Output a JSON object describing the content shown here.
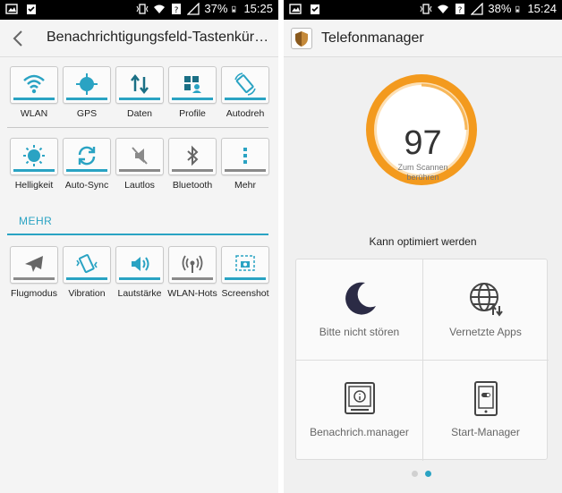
{
  "left": {
    "status": {
      "battery": "37%",
      "time": "15:25"
    },
    "title": "Benachrichtigungsfeld-Tastenkür…",
    "row1": [
      {
        "label": "WLAN",
        "icon": "wifi-icon",
        "active": true
      },
      {
        "label": "GPS",
        "icon": "gps-icon",
        "active": true
      },
      {
        "label": "Daten",
        "icon": "data-transfer-icon",
        "active": true
      },
      {
        "label": "Profile",
        "icon": "profile-icon",
        "active": true
      },
      {
        "label": "Autodreh",
        "icon": "rotate-icon",
        "active": true
      }
    ],
    "row2": [
      {
        "label": "Helligkeit",
        "icon": "brightness-icon",
        "active": true
      },
      {
        "label": "Auto-Sync",
        "icon": "sync-icon",
        "active": true
      },
      {
        "label": "Lautlos",
        "icon": "silent-icon",
        "active": false
      },
      {
        "label": "Bluetooth",
        "icon": "bluetooth-icon",
        "active": false
      },
      {
        "label": "Mehr",
        "icon": "more-icon",
        "active": false
      }
    ],
    "mehr_heading": "MEHR",
    "row3": [
      {
        "label": "Flugmodus",
        "icon": "airplane-icon",
        "active": false
      },
      {
        "label": "Vibration",
        "icon": "vibration-icon",
        "active": true
      },
      {
        "label": "Lautstärke",
        "icon": "volume-icon",
        "active": true
      },
      {
        "label": "WLAN-Hots",
        "icon": "hotspot-icon",
        "active": false
      },
      {
        "label": "Screenshot",
        "icon": "screenshot-icon",
        "active": true
      }
    ]
  },
  "right": {
    "status": {
      "battery": "38%",
      "time": "15:24"
    },
    "title": "Telefonmanager",
    "score": "97",
    "scan_line1": "Zum Scannen",
    "scan_line2": "berühren",
    "optimize_text": "Kann optimiert werden",
    "cells": [
      {
        "label": "Bitte nicht stören",
        "icon": "moon-icon"
      },
      {
        "label": "Vernetzte Apps",
        "icon": "globe-network-icon"
      },
      {
        "label": "Benachrich.manager",
        "icon": "notification-manager-icon"
      },
      {
        "label": "Start-Manager",
        "icon": "startup-manager-icon"
      }
    ]
  },
  "colors": {
    "accent": "#2aa3c3",
    "gauge_orange": "#f39a1e"
  }
}
